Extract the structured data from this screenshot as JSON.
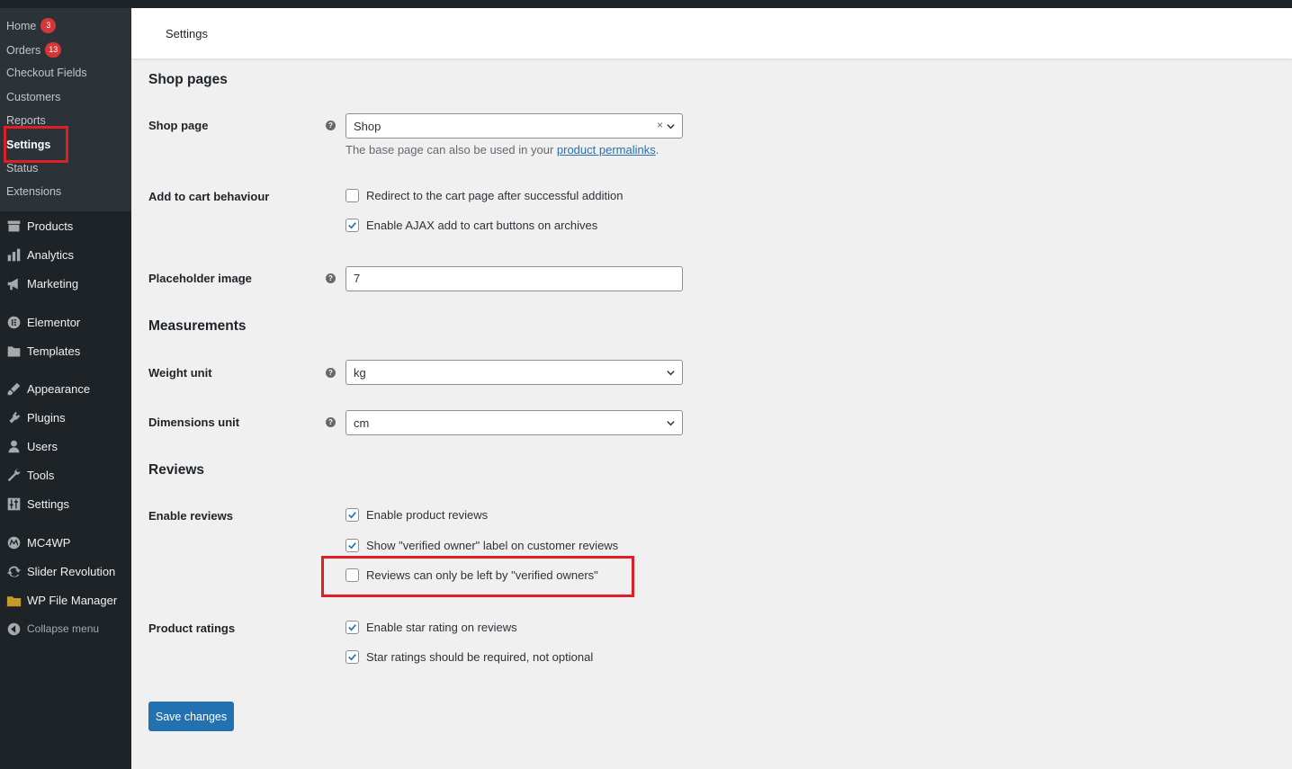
{
  "header": {
    "title": "Settings"
  },
  "sidebar": {
    "submenu": [
      {
        "label": "Home",
        "badge": "3"
      },
      {
        "label": "Orders",
        "badge": "13"
      },
      {
        "label": "Checkout Fields"
      },
      {
        "label": "Customers"
      },
      {
        "label": "Reports"
      },
      {
        "label": "Settings"
      },
      {
        "label": "Status"
      },
      {
        "label": "Extensions"
      }
    ],
    "menu": [
      {
        "label": "Products",
        "icon": "archive-icon"
      },
      {
        "label": "Analytics",
        "icon": "bar-chart-icon"
      },
      {
        "label": "Marketing",
        "icon": "megaphone-icon"
      },
      {
        "label": "Elementor",
        "icon": "elementor-icon"
      },
      {
        "label": "Templates",
        "icon": "folder-icon"
      },
      {
        "label": "Appearance",
        "icon": "paintbrush-icon"
      },
      {
        "label": "Plugins",
        "icon": "plug-icon"
      },
      {
        "label": "Users",
        "icon": "user-icon"
      },
      {
        "label": "Tools",
        "icon": "wrench-icon"
      },
      {
        "label": "Settings",
        "icon": "sliders-icon"
      },
      {
        "label": "MC4WP",
        "icon": "mc4wp-icon"
      },
      {
        "label": "Slider Revolution",
        "icon": "refresh-icon"
      },
      {
        "label": "WP File Manager",
        "icon": "file-manager-icon"
      },
      {
        "label": "Collapse menu",
        "icon": "collapse-arrow-icon"
      }
    ]
  },
  "shop_pages": {
    "title": "Shop pages",
    "shop_page": {
      "label": "Shop page",
      "value": "Shop",
      "clear": "×",
      "desc_prefix": "The base page can also be used in your ",
      "desc_link": "product permalinks",
      "desc_suffix": "."
    },
    "add_to_cart": {
      "label": "Add to cart behaviour",
      "options": [
        {
          "label": "Redirect to the cart page after successful addition",
          "checked": false
        },
        {
          "label": "Enable AJAX add to cart buttons on archives",
          "checked": true
        }
      ]
    },
    "placeholder_image": {
      "label": "Placeholder image",
      "value": "7"
    }
  },
  "measurements": {
    "title": "Measurements",
    "weight_unit": {
      "label": "Weight unit",
      "value": "kg"
    },
    "dimensions_unit": {
      "label": "Dimensions unit",
      "value": "cm"
    }
  },
  "reviews": {
    "title": "Reviews",
    "enable_reviews": {
      "label": "Enable reviews",
      "options": [
        {
          "label": "Enable product reviews",
          "checked": true
        },
        {
          "label": "Show \"verified owner\" label on customer reviews",
          "checked": true
        },
        {
          "label": "Reviews can only be left by \"verified owners\"",
          "checked": false
        }
      ]
    },
    "product_ratings": {
      "label": "Product ratings",
      "options": [
        {
          "label": "Enable star rating on reviews",
          "checked": true
        },
        {
          "label": "Star ratings should be required, not optional",
          "checked": true
        }
      ]
    }
  },
  "actions": {
    "save_label": "Save changes"
  },
  "colors": {
    "sidebar_bg": "#1d2327",
    "submenu_bg": "#2c3338",
    "accent": "#2271b1",
    "badge": "#d63638",
    "highlight": "#e01e25"
  }
}
